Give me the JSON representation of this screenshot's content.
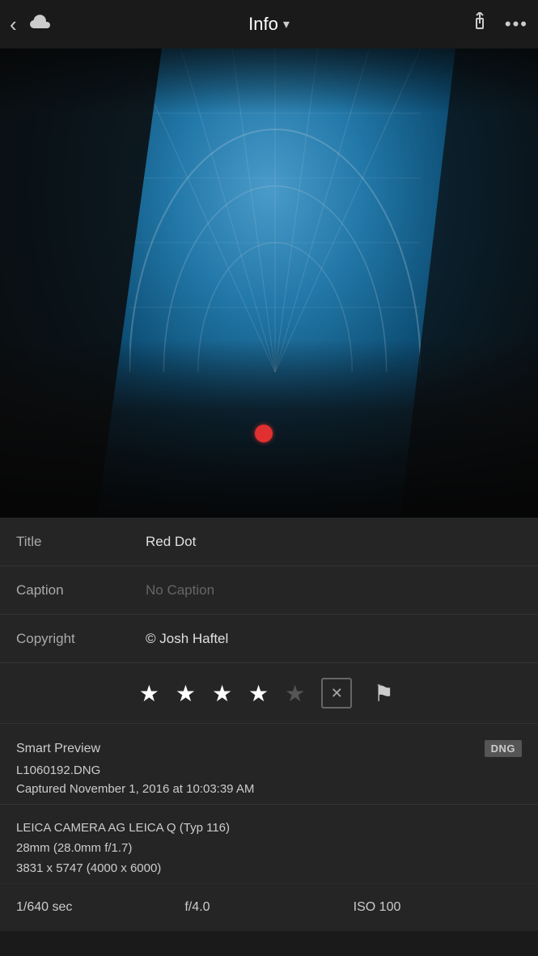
{
  "header": {
    "back_label": "‹",
    "cloud_icon": "☁",
    "info_label": "Info",
    "chevron": "▾",
    "more_icon": "•••"
  },
  "photo": {
    "red_dot_visible": true
  },
  "metadata": {
    "title_label": "Title",
    "title_value": "Red Dot",
    "caption_label": "Caption",
    "caption_placeholder": "No Caption",
    "copyright_label": "Copyright",
    "copyright_value": "© Josh Haftel"
  },
  "stars": {
    "filled": 4,
    "total": 5
  },
  "smart_preview": {
    "label": "Smart Preview",
    "badge": "DNG",
    "filename": "L1060192.DNG",
    "captured": "Captured November 1, 2016 at 10:03:39 AM"
  },
  "camera": {
    "model": "LEICA CAMERA AG LEICA Q (Typ 116)",
    "lens": "28mm (28.0mm f/1.7)",
    "resolution": "3831 x 5747 (4000 x 6000)"
  },
  "exposure": {
    "shutter": "1/640 sec",
    "aperture": "f/4.0",
    "iso": "ISO 100"
  }
}
